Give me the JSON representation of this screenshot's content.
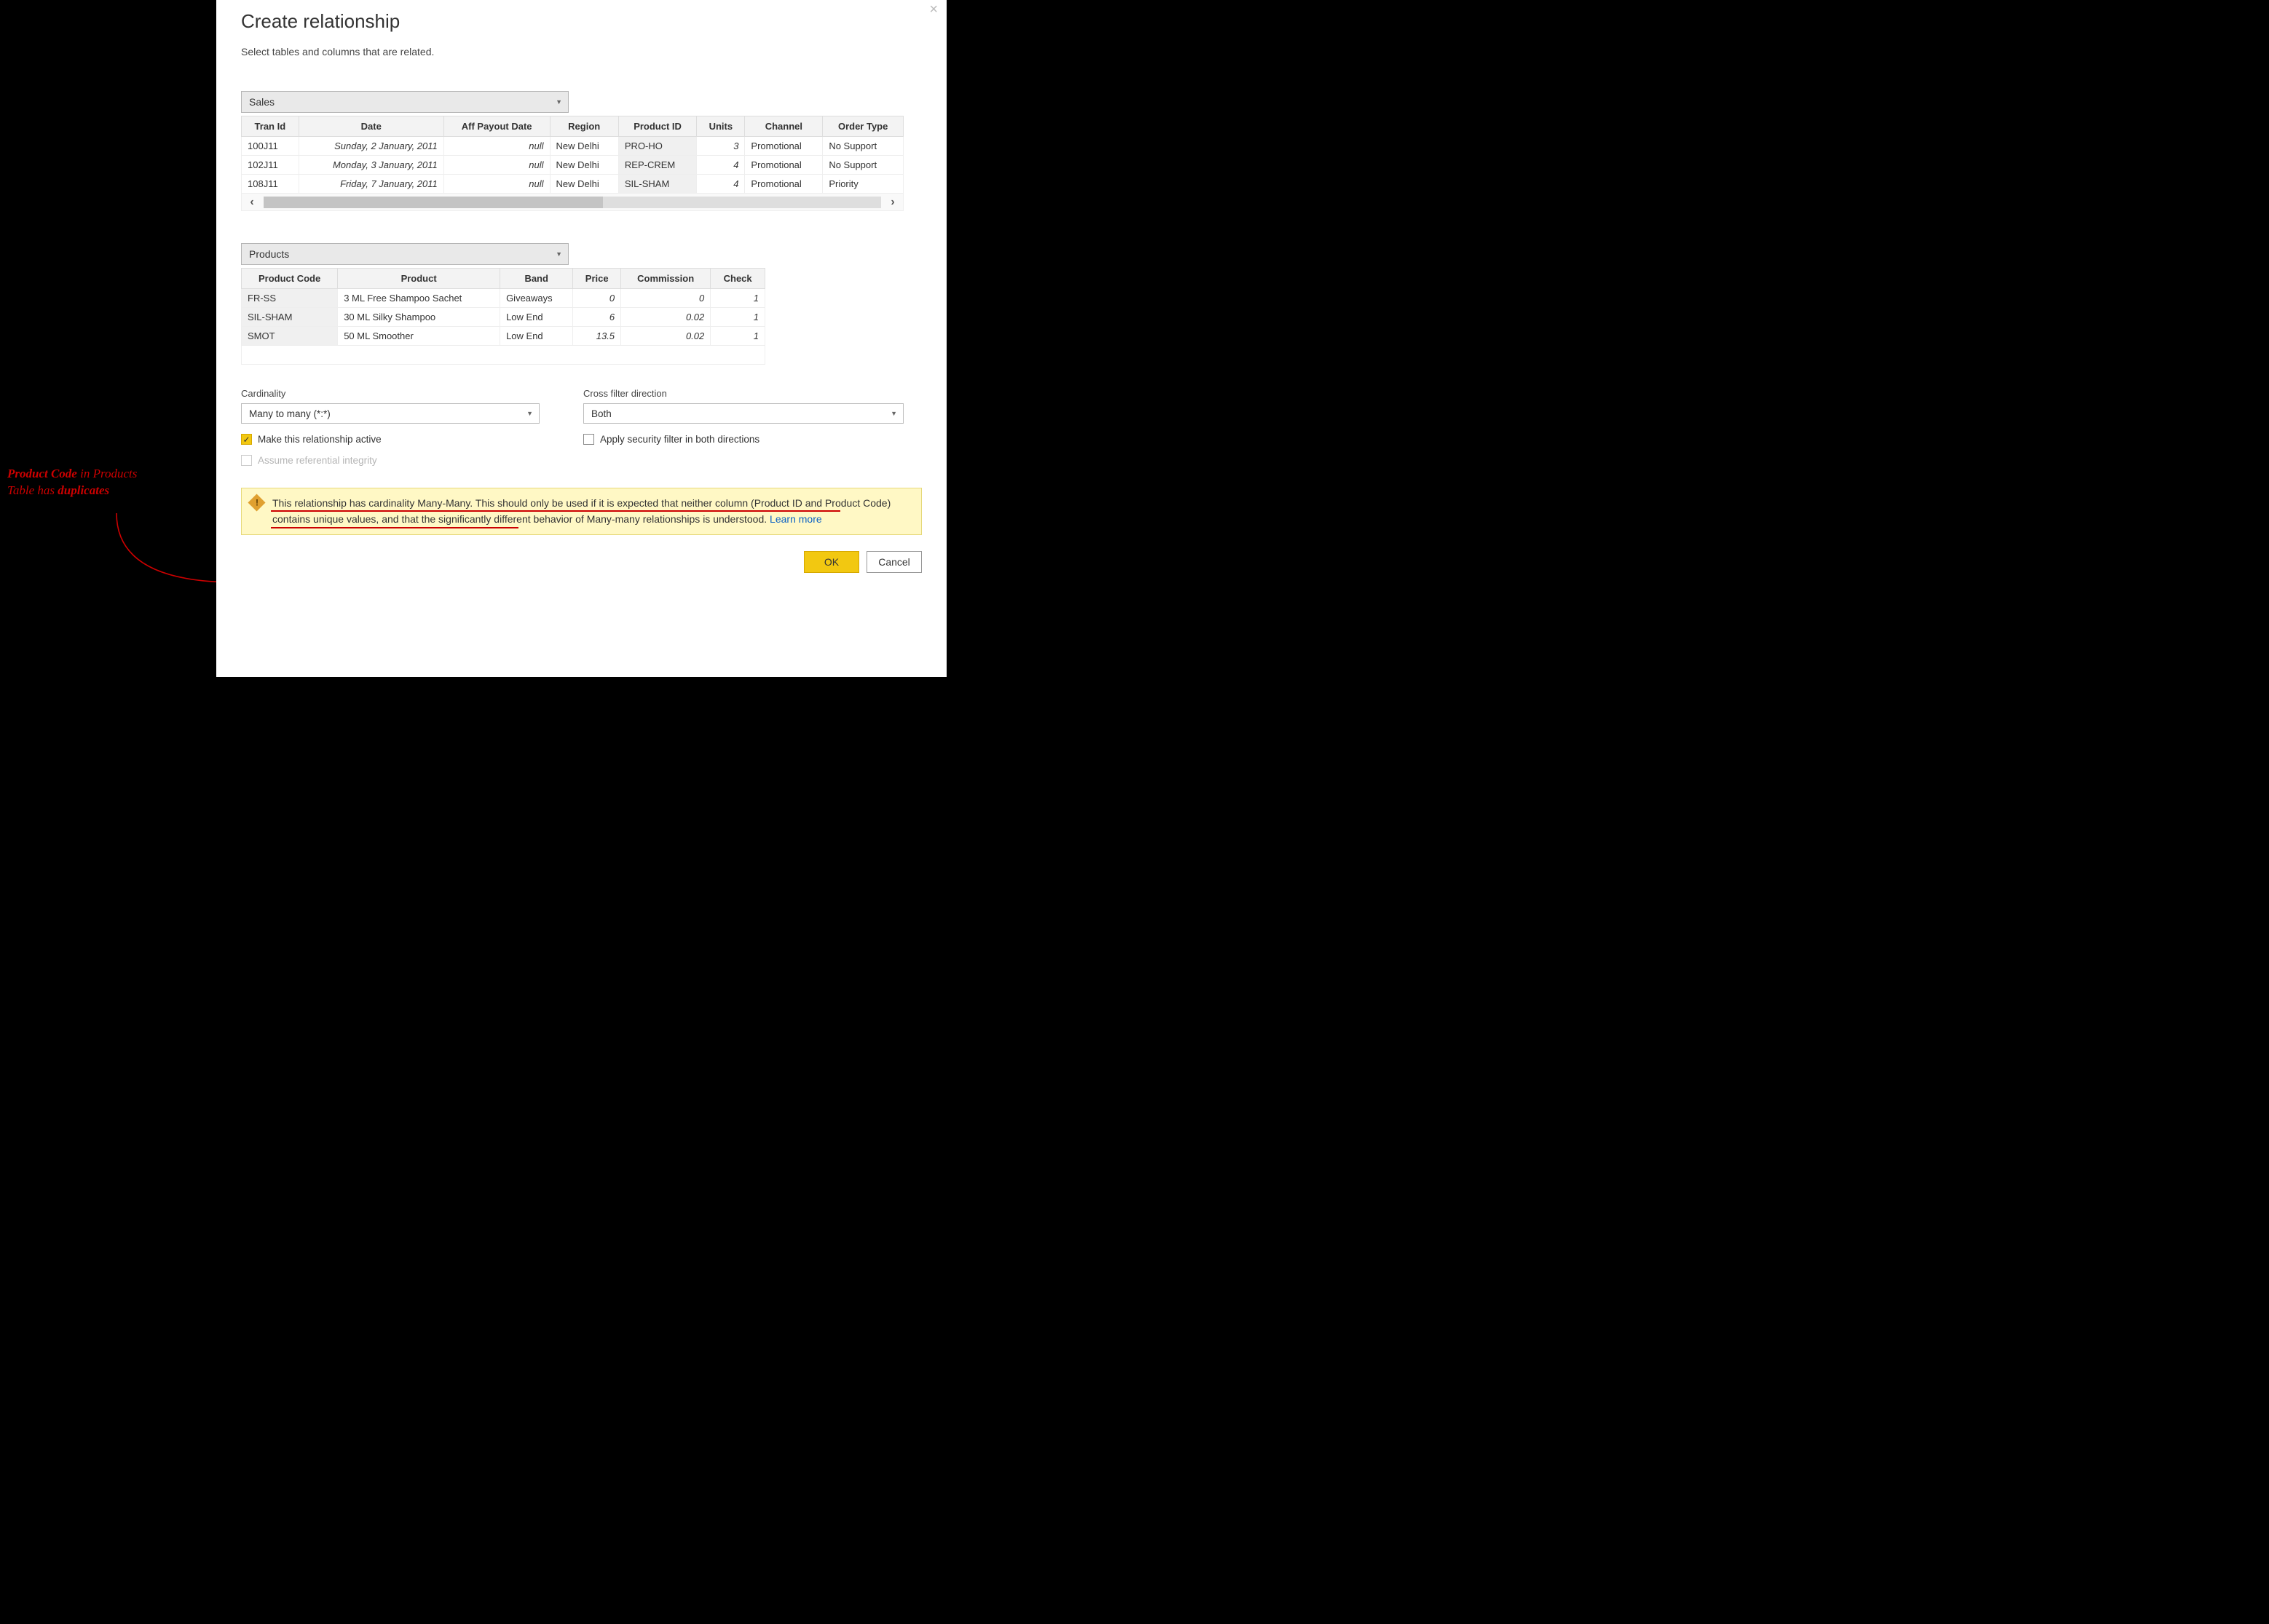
{
  "dialog": {
    "title": "Create relationship",
    "subtitle": "Select tables and columns that are related."
  },
  "annotation": {
    "part1_strong": "Product Code",
    "part1_rest": " in Products",
    "part2_pre": "Table has ",
    "part2_strong": "duplicates"
  },
  "table1": {
    "select_value": "Sales",
    "headers": [
      "Tran Id",
      "Date",
      "Aff Payout Date",
      "Region",
      "Product ID",
      "Units",
      "Channel",
      "Order Type"
    ],
    "rows": [
      {
        "tran": "100J11",
        "date": "Sunday, 2 January, 2011",
        "payout": "null",
        "region": "New Delhi",
        "pid": "PRO-HO",
        "units": "3",
        "channel": "Promotional",
        "otype": "No Support"
      },
      {
        "tran": "102J11",
        "date": "Monday, 3 January, 2011",
        "payout": "null",
        "region": "New Delhi",
        "pid": "REP-CREM",
        "units": "4",
        "channel": "Promotional",
        "otype": "No Support"
      },
      {
        "tran": "108J11",
        "date": "Friday, 7 January, 2011",
        "payout": "null",
        "region": "New Delhi",
        "pid": "SIL-SHAM",
        "units": "4",
        "channel": "Promotional",
        "otype": "Priority"
      }
    ]
  },
  "table2": {
    "select_value": "Products",
    "headers": [
      "Product Code",
      "Product",
      "Band",
      "Price",
      "Commission",
      "Check"
    ],
    "rows": [
      {
        "code": "FR-SS",
        "product": "3 ML Free Shampoo Sachet",
        "band": "Giveaways",
        "price": "0",
        "comm": "0",
        "check": "1"
      },
      {
        "code": "SIL-SHAM",
        "product": "30 ML Silky Shampoo",
        "band": "Low End",
        "price": "6",
        "comm": "0.02",
        "check": "1"
      },
      {
        "code": "SMOT",
        "product": "50 ML Smoother",
        "band": "Low End",
        "price": "13.5",
        "comm": "0.02",
        "check": "1"
      }
    ]
  },
  "options": {
    "cardinality_label": "Cardinality",
    "cardinality_value": "Many to many (*:*)",
    "crossfilter_label": "Cross filter direction",
    "crossfilter_value": "Both",
    "make_active": "Make this relationship active",
    "apply_security": "Apply security filter in both directions",
    "assume_ref": "Assume referential integrity"
  },
  "warning": {
    "text_1": "This relationship has cardinality Many-Many. This should only be used if it is expected that neither column (Product ID and Product Code) contains unique values, and that the significantly different behavior of Many-many relationships is understood. ",
    "learn_more": "Learn more"
  },
  "buttons": {
    "ok": "OK",
    "cancel": "Cancel"
  }
}
